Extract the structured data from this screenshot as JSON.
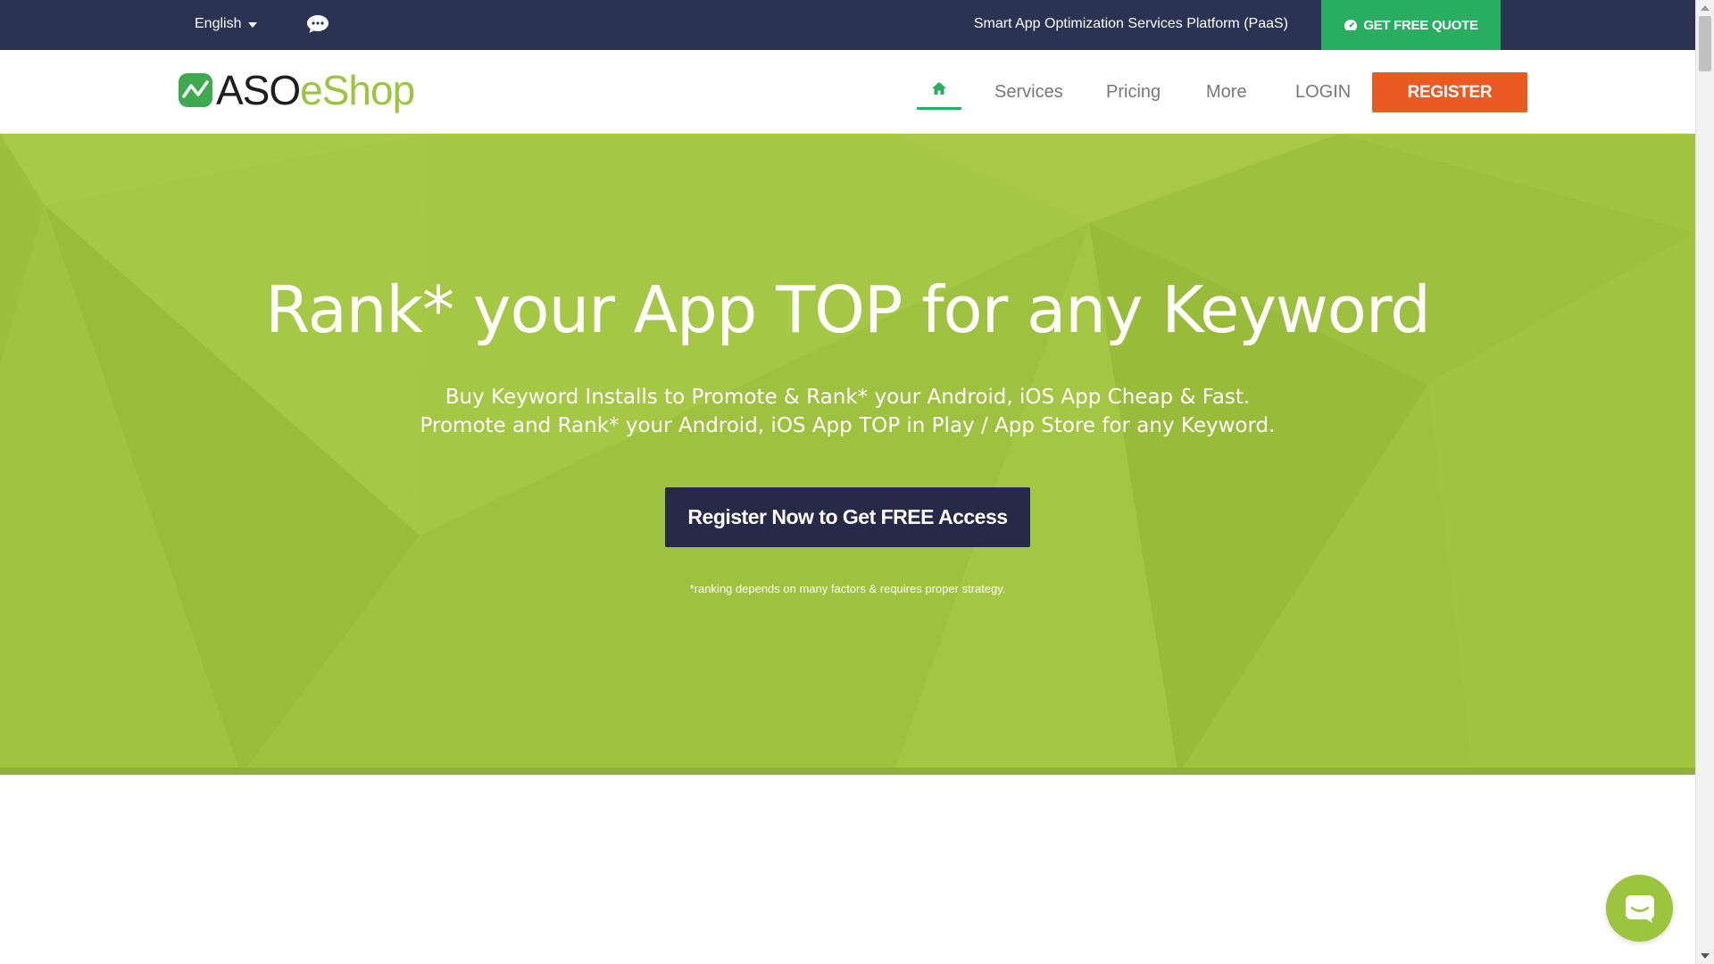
{
  "topbar": {
    "language": "English",
    "chat_icon": "chat-bubble-icon",
    "tagline": "Smart App Optimization Services Platform (PaaS)",
    "quote_button": "GET FREE QUOTE",
    "quote_icon": "dashboard-icon"
  },
  "header": {
    "logo_part1": "ASO",
    "logo_part2": "eShop",
    "nav": {
      "home_icon": "home-icon",
      "services": "Services",
      "pricing": "Pricing",
      "more": "More",
      "login": "LOGIN",
      "register": "REGISTER"
    }
  },
  "hero": {
    "title": "Rank* your App TOP for any Keyword",
    "subtitle_line1": "Buy Keyword Installs to Promote & Rank* your Android, iOS App Cheap & Fast.",
    "subtitle_line2": "Promote and Rank* your Android, iOS App TOP in Play / App Store for any Keyword.",
    "cta": "Register Now to Get FREE Access",
    "disclaimer": "*ranking depends on many factors & requires proper strategy."
  },
  "chat_widget": {
    "icon": "messenger-icon"
  },
  "colors": {
    "topbar": "#2a3452",
    "quote_green": "#27ae60",
    "register_orange": "#ec5a24",
    "hero_green": "#a2c541",
    "cta_navy": "#262a48",
    "logo_green": "#9bc53d"
  }
}
